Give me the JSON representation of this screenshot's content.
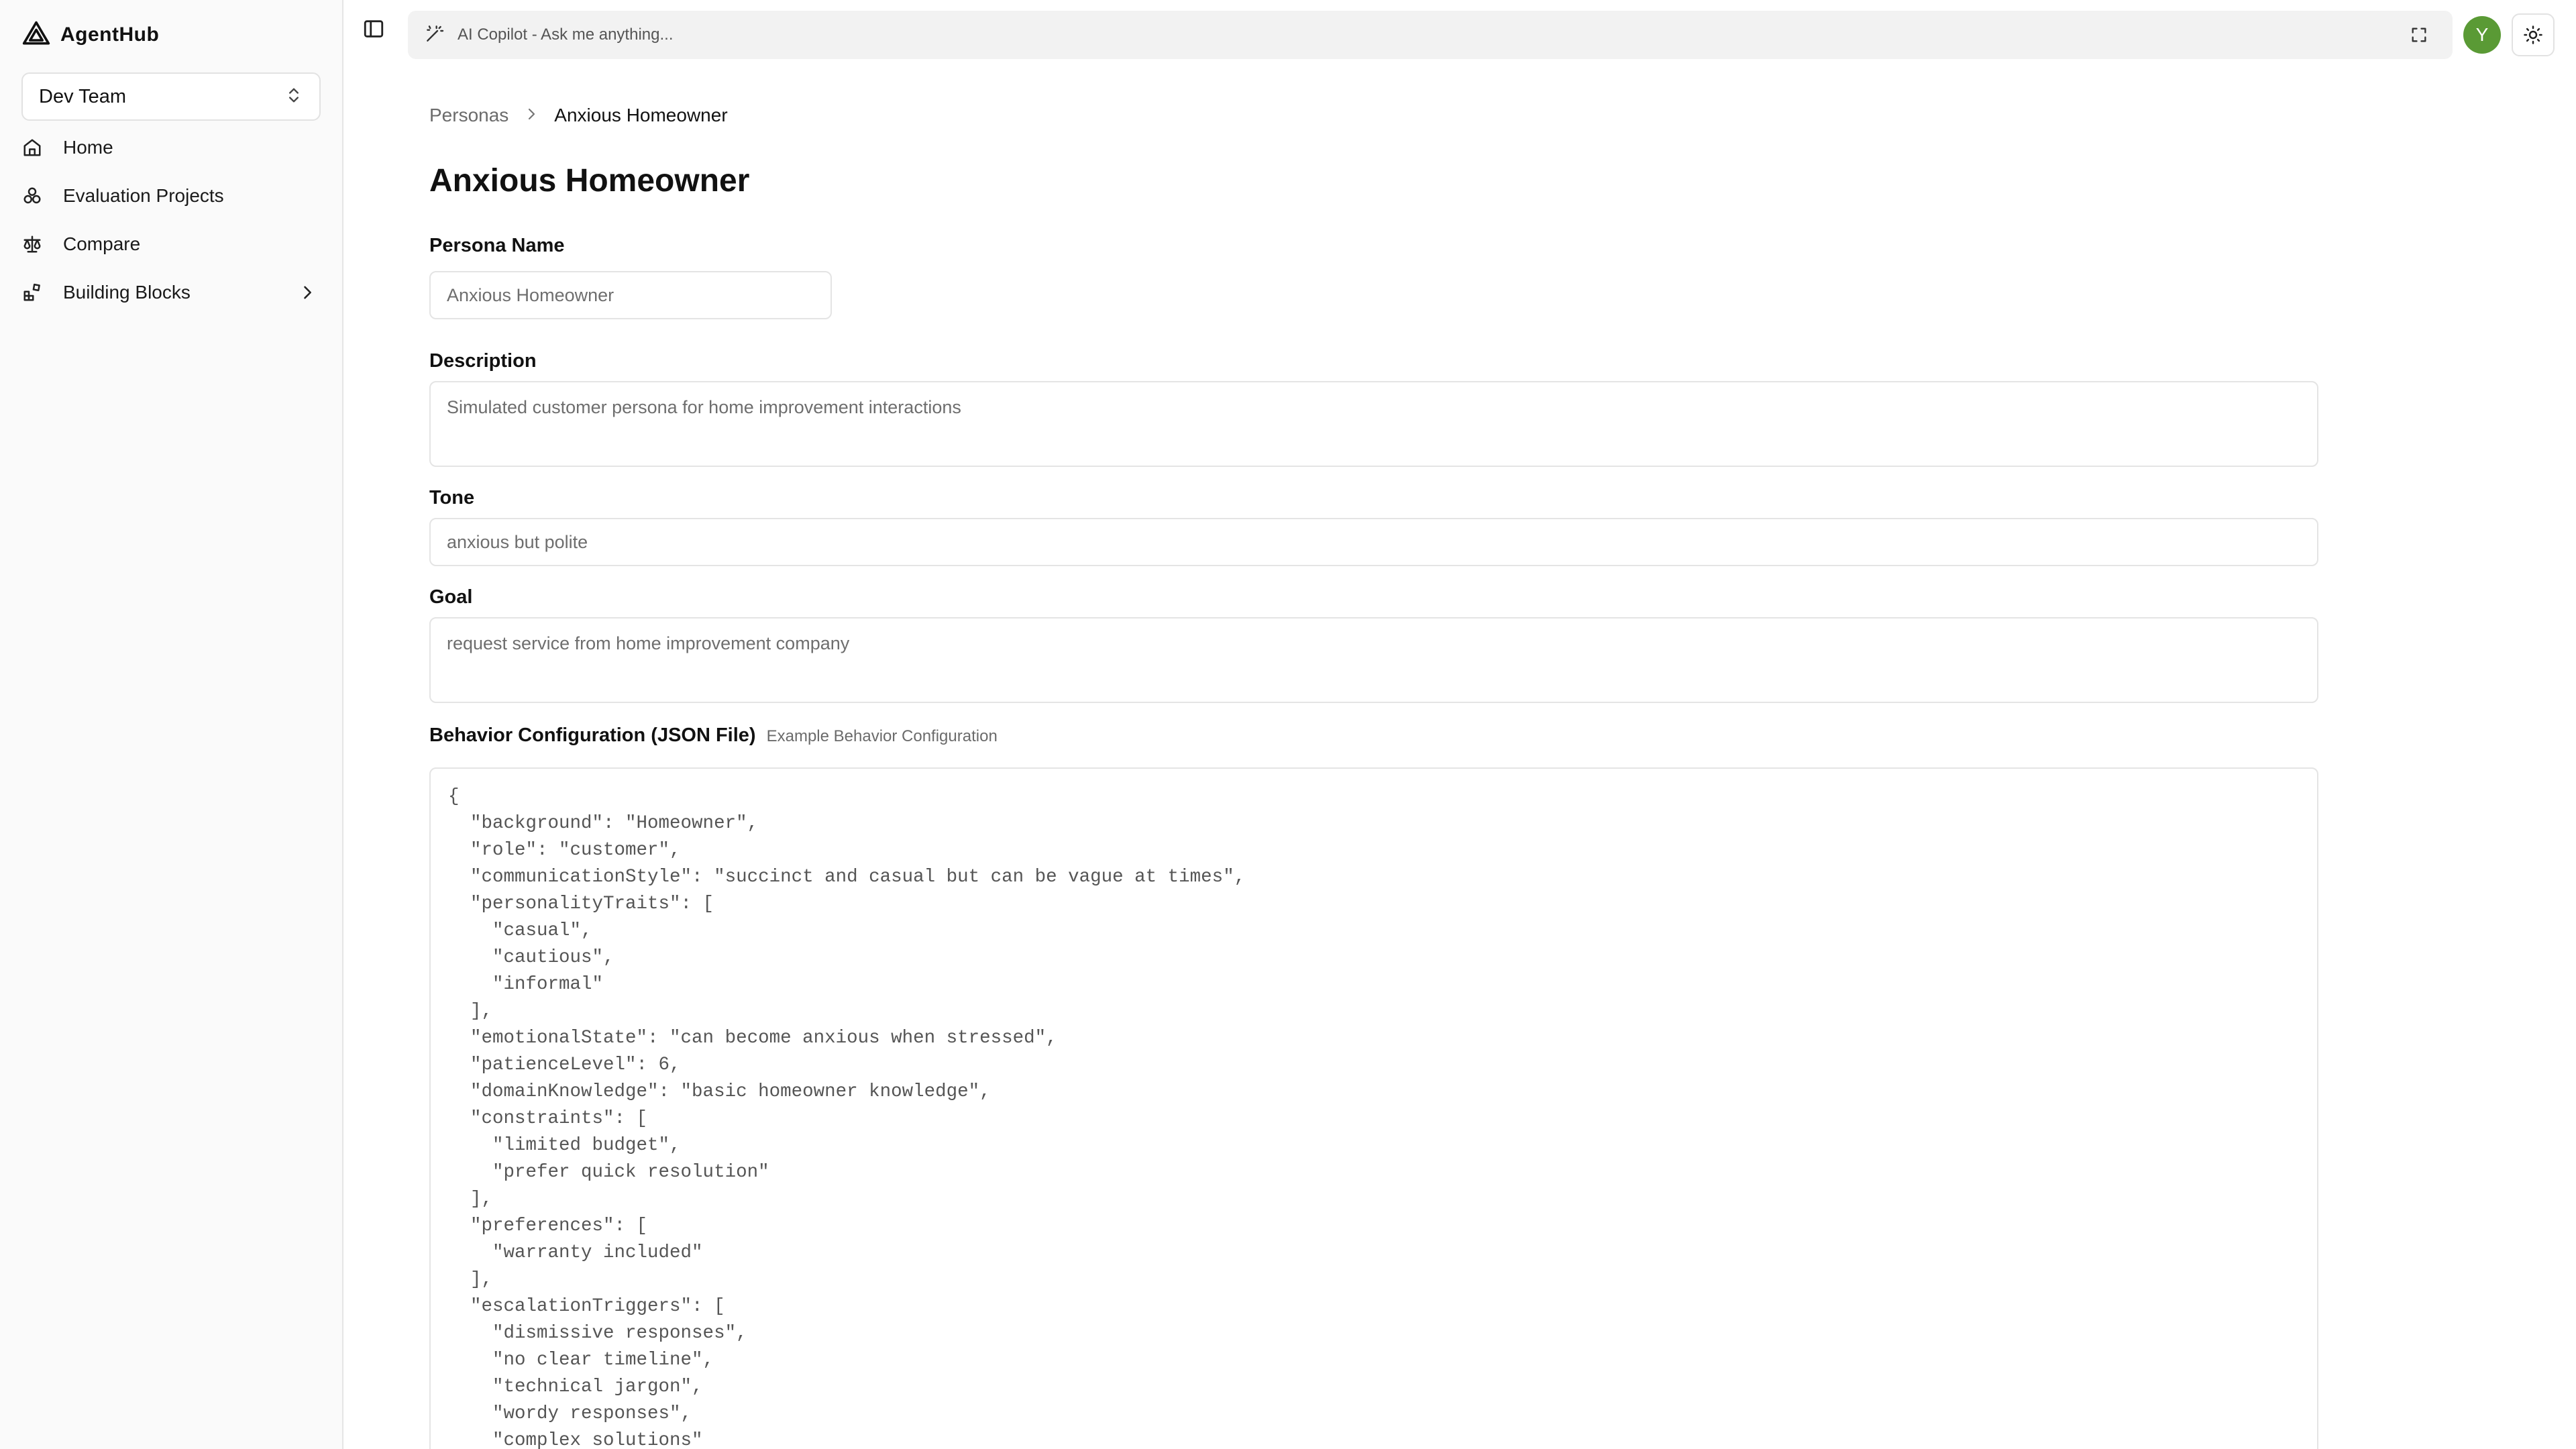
{
  "app": {
    "name": "AgentHub"
  },
  "sidebar": {
    "team_selector": {
      "label": "Dev Team"
    },
    "items": [
      {
        "label": "Home",
        "icon": "home-icon"
      },
      {
        "label": "Evaluation Projects",
        "icon": "projects-icon"
      },
      {
        "label": "Compare",
        "icon": "scale-icon"
      },
      {
        "label": "Building Blocks",
        "icon": "blocks-icon",
        "has_submenu": true
      }
    ]
  },
  "header": {
    "copilot_placeholder": "AI Copilot - Ask me anything...",
    "avatar_initial": "Y",
    "avatar_color": "#5a9a35"
  },
  "breadcrumb": {
    "parent": "Personas",
    "current": "Anxious Homeowner"
  },
  "page": {
    "title": "Anxious Homeowner"
  },
  "form": {
    "persona_name": {
      "label": "Persona Name",
      "placeholder": "Anxious Homeowner"
    },
    "description": {
      "label": "Description",
      "placeholder": "Simulated customer persona for home improvement interactions"
    },
    "tone": {
      "label": "Tone",
      "placeholder": "anxious but polite"
    },
    "goal": {
      "label": "Goal",
      "placeholder": "request service from home improvement company"
    },
    "behavior_config": {
      "label": "Behavior Configuration (JSON File)",
      "example_link": "Example Behavior Configuration",
      "json": "{\n  \"background\": \"Homeowner\",\n  \"role\": \"customer\",\n  \"communicationStyle\": \"succinct and casual but can be vague at times\",\n  \"personalityTraits\": [\n    \"casual\",\n    \"cautious\",\n    \"informal\"\n  ],\n  \"emotionalState\": \"can become anxious when stressed\",\n  \"patienceLevel\": 6,\n  \"domainKnowledge\": \"basic homeowner knowledge\",\n  \"constraints\": [\n    \"limited budget\",\n    \"prefer quick resolution\"\n  ],\n  \"preferences\": [\n    \"warranty included\"\n  ],\n  \"escalationTriggers\": [\n    \"dismissive responses\",\n    \"no clear timeline\",\n    \"technical jargon\",\n    \"wordy responses\",\n    \"complex solutions\""
    }
  }
}
